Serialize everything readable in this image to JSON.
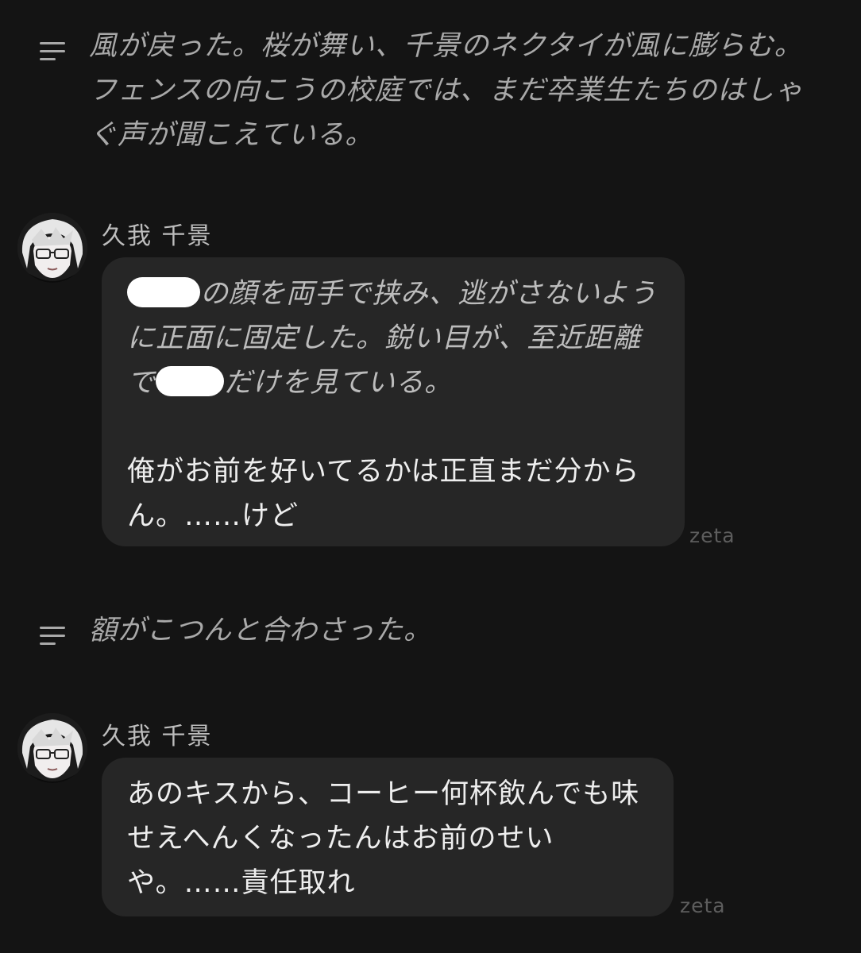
{
  "narration_1": {
    "text": "風が戻った。桜が舞い、千景のネクタイが風に膨らむ。フェンスの向こうの校庭では、まだ卒業生たちのはしゃぐ声が聞こえている。"
  },
  "message_1": {
    "sender": "久我 千景",
    "action_line_1_after": "の顔を両手で挟み、逃がさないように正面に固定した。鋭い目が、至近距離で",
    "action_line_1_end": "だけを見ている。",
    "speech": "俺がお前を好いてるかは正直まだ分からん。……けど",
    "watermark": "zeta"
  },
  "narration_2": {
    "text": "額がこつんと合わさった。"
  },
  "message_2": {
    "sender": "久我 千景",
    "speech": "あのキスから、コーヒー何杯飲んでも味せえへんくなったんはお前のせいや。……責任取れ",
    "watermark": "zeta"
  },
  "icons": {
    "narration": "text-lines-icon",
    "avatar": "character-avatar"
  },
  "colors": {
    "background": "#141414",
    "bubble": "#262626",
    "narration_text": "#a9a9a9",
    "watermark": "#5d5d5d"
  }
}
